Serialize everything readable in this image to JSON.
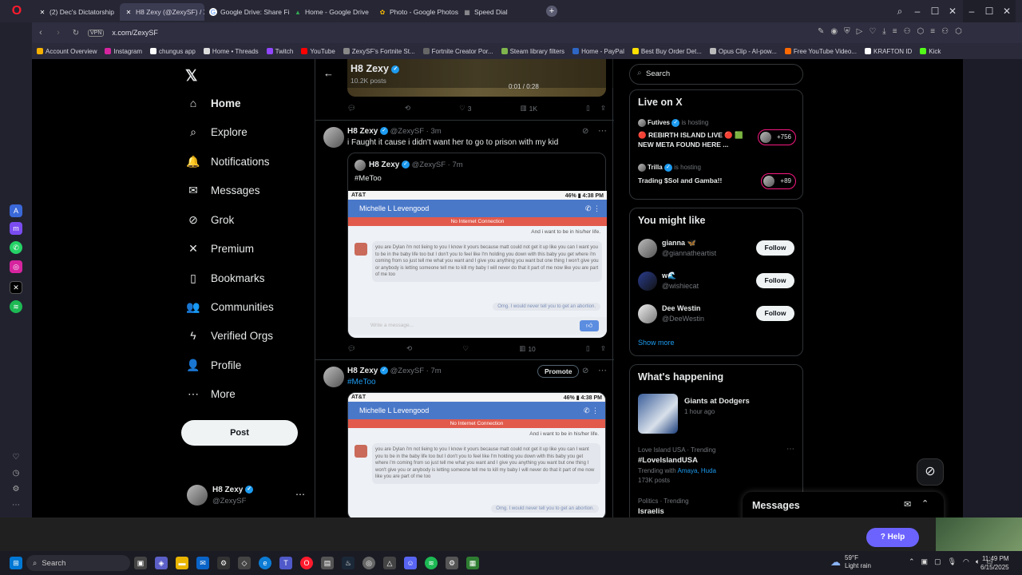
{
  "browser": {
    "tabs": [
      {
        "label": "(2) Dec's Dictatorship",
        "icon": "x-logo-icon",
        "active": false
      },
      {
        "label": "H8 Zexy (@ZexySF) / X",
        "icon": "x-logo-icon",
        "active": true
      },
      {
        "label": "Google Drive: Share Files",
        "icon": "google-icon",
        "active": false
      },
      {
        "label": "Home - Google Drive",
        "icon": "drive-icon",
        "active": false
      },
      {
        "label": "Photo - Google Photos",
        "icon": "photos-icon",
        "active": false
      },
      {
        "label": "Speed Dial",
        "icon": "speed-dial-icon",
        "active": false
      }
    ],
    "url": "x.com/ZexySF",
    "vpn_label": "VPN",
    "bookmarks": [
      "Account Overview",
      "Instagram",
      "chungus app",
      "Home • Threads",
      "Twitch",
      "YouTube",
      "ZexySF's Fortnite St...",
      "Fortnite Creator Por...",
      "Steam library filters",
      "Home - PayPal",
      "Best Buy Order Det...",
      "Opus Clip - AI-pow...",
      "Free YouTube Video...",
      "KRAFTON ID",
      "Kick"
    ]
  },
  "nav": {
    "items": [
      {
        "label": "Home",
        "icon": "home-icon",
        "glyph": "⌂"
      },
      {
        "label": "Explore",
        "icon": "search-icon",
        "glyph": "⌕"
      },
      {
        "label": "Notifications",
        "icon": "bell-icon",
        "glyph": "🔔"
      },
      {
        "label": "Messages",
        "icon": "mail-icon",
        "glyph": "✉"
      },
      {
        "label": "Grok",
        "icon": "grok-icon",
        "glyph": "⊘"
      },
      {
        "label": "Premium",
        "icon": "x-premium-icon",
        "glyph": "✕"
      },
      {
        "label": "Bookmarks",
        "icon": "bookmark-icon",
        "glyph": "▯"
      },
      {
        "label": "Communities",
        "icon": "communities-icon",
        "glyph": "👥"
      },
      {
        "label": "Verified Orgs",
        "icon": "lightning-icon",
        "glyph": "ϟ"
      },
      {
        "label": "Profile",
        "icon": "person-icon",
        "glyph": "👤"
      },
      {
        "label": "More",
        "icon": "more-circle-icon",
        "glyph": "⋯"
      }
    ],
    "post_label": "Post",
    "account": {
      "name": "H8 Zexy",
      "handle": "@ZexySF"
    }
  },
  "header": {
    "name": "H8 Zexy",
    "posts": "10.2K posts",
    "video_time": "0:01 / 0:28"
  },
  "top_actions": {
    "likes": "3",
    "views": "1K"
  },
  "tweets": [
    {
      "name": "H8 Zexy",
      "handle": "@ZexySF",
      "time": "3m",
      "text": "i Faught it cause i didn't want her to go to prison with my kid",
      "quote": {
        "name": "H8 Zexy",
        "handle": "@ZexySF",
        "time": "7m",
        "text": "#MeToo"
      },
      "views": "10"
    },
    {
      "name": "H8 Zexy",
      "handle": "@ZexySF",
      "time": "7m",
      "text": "#MeToo",
      "promote_label": "Promote"
    }
  ],
  "screenshot": {
    "carrier": "AT&T",
    "battery": "46%",
    "clock": "4:38 PM",
    "contact": "Michelle L Levengood",
    "no_connection": "No Internet Connection",
    "msg_top": "And i want to be in his/her life.",
    "msg_body": "you are Dylan i'm not lieing to you I know it yours because matt could not get it up like you can I want you to be in the baby life too but I don't you to feel like I'm holding you down with this baby you get where i'm coming from so just tell me what you want and I give you anything you want but one thing I won't give you or anybody is letting someone tell me to kill my baby I will never do that it part of me now like you are part of me too",
    "msg_reply": "Omg. I would never tell you to get an abortion.",
    "input_placeholder": "Write a message..."
  },
  "search": {
    "placeholder": "Search"
  },
  "live": {
    "title": "Live on X",
    "items": [
      {
        "host": "Futives",
        "status": "is hosting",
        "title": "🔴 REBIRTH ISLAND LIVE 🔴 🟩 NEW META FOUND HERE ...",
        "count": "+756"
      },
      {
        "host": "Trilla",
        "status": "is hosting",
        "title": "Trading $Sol and Gamba!!",
        "count": "+89"
      }
    ]
  },
  "might_like": {
    "title": "You might like",
    "users": [
      {
        "name": "gianna 🦋",
        "handle": "@giannatheartist"
      },
      {
        "name": "w🌊",
        "handle": "@wishiecat"
      },
      {
        "name": "Dee Westin",
        "handle": "@DeeWestin"
      }
    ],
    "follow_label": "Follow",
    "show_more": "Show more"
  },
  "happening": {
    "title": "What's happening",
    "event": {
      "title": "Giants at Dodgers",
      "time": "1 hour ago"
    },
    "trends": [
      {
        "context": "Love Island USA · Trending",
        "name": "#LoveIslandUSA",
        "with_label": "Trending with",
        "with": "Amaya, Huda",
        "posts": "173K posts"
      },
      {
        "context": "Politics · Trending",
        "name": "Israelis"
      }
    ]
  },
  "messages_drawer": {
    "title": "Messages"
  },
  "help_label": "Help",
  "taskbar": {
    "search_label": "Search",
    "weather_temp": "59°F",
    "weather_desc": "Light rain",
    "time": "11:49 PM",
    "date": "6/15/2025"
  },
  "colors": {
    "accent": "#1d9bf0",
    "chat_header": "#4a78c9",
    "no_connection": "#e15a4c",
    "opera_red": "#ff1b2d"
  }
}
